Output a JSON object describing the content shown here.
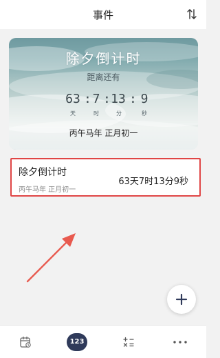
{
  "header": {
    "title": "事件"
  },
  "hero": {
    "title": "除夕倒计时",
    "subtitle": "距离还有",
    "days": "63",
    "hours": "7",
    "minutes": "13",
    "seconds": "9",
    "separator": ":",
    "unit_days": "天",
    "unit_hours": "时",
    "unit_minutes": "分",
    "unit_seconds": "秒",
    "date": "丙午马年 正月初一"
  },
  "events": [
    {
      "name": "除夕倒计时",
      "date": "丙午马年 正月初一",
      "countdown": "63天7时13分9秒"
    }
  ],
  "tabbar": {
    "calculator_label": "123"
  },
  "colors": {
    "highlight_border": "#e04545",
    "arrow": "#e85a4f",
    "badge_bg": "#2f3a5a"
  }
}
